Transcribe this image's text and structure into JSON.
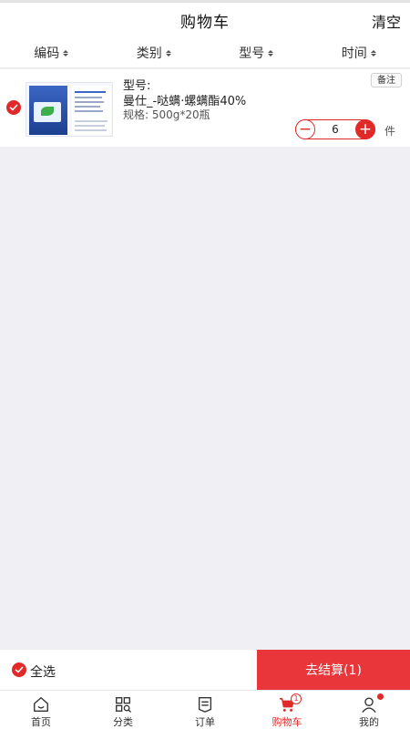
{
  "header": {
    "title": "购物车",
    "clear_label": "清空"
  },
  "sort_bar": {
    "items": [
      {
        "label": "编码"
      },
      {
        "label": "类别"
      },
      {
        "label": "型号"
      },
      {
        "label": "时间"
      }
    ]
  },
  "cart": {
    "items": [
      {
        "checked": true,
        "type_label": "型号:",
        "name": "曼仕_-哒螨·螺螨酯40%",
        "spec": "规格:  500g*20瓶",
        "remark_label": "备注",
        "quantity": "6",
        "unit": "件",
        "minus_icon": "minus-icon",
        "plus_icon": "plus-icon",
        "image_icon": "product-image"
      }
    ]
  },
  "bottom_bar": {
    "select_all_label": "全选",
    "select_all_checked": true,
    "checkout_label": "去结算(1)"
  },
  "tabbar": {
    "tabs": [
      {
        "label": "首页",
        "icon": "home-icon"
      },
      {
        "label": "分类",
        "icon": "category-icon"
      },
      {
        "label": "订单",
        "icon": "order-icon"
      },
      {
        "label": "购物车",
        "icon": "cart-icon",
        "active": true,
        "badge": "1"
      },
      {
        "label": "我的",
        "icon": "user-icon",
        "dot": true
      }
    ]
  },
  "colors": {
    "accent": "#e02a2a",
    "checkout_bg": "#e8363b",
    "page_bg": "#efeff4"
  }
}
